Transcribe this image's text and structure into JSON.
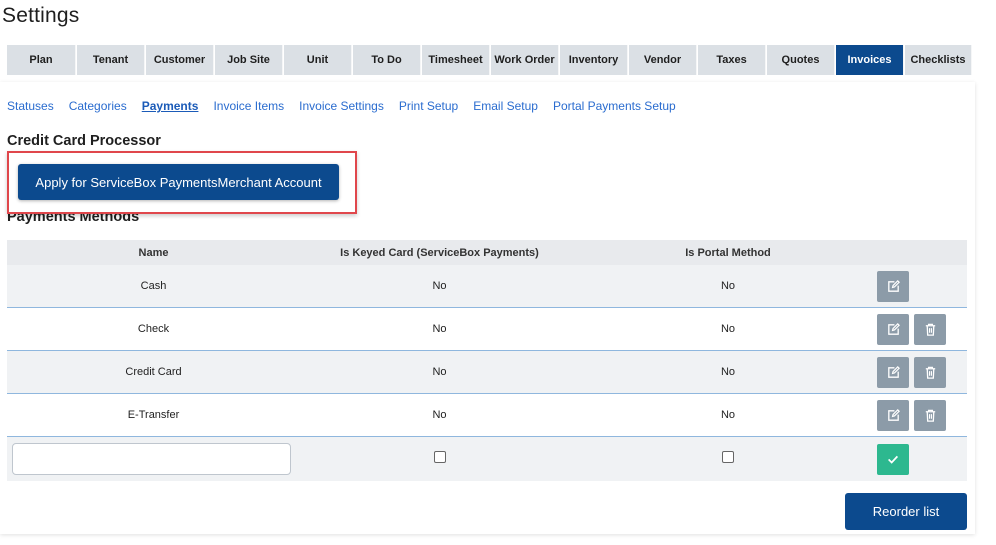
{
  "page": {
    "title": "Settings"
  },
  "tabs": [
    {
      "label": "Plan",
      "active": false
    },
    {
      "label": "Tenant",
      "active": false
    },
    {
      "label": "Customer",
      "active": false
    },
    {
      "label": "Job Site",
      "active": false
    },
    {
      "label": "Unit",
      "active": false
    },
    {
      "label": "To Do",
      "active": false
    },
    {
      "label": "Timesheet",
      "active": false
    },
    {
      "label": "Work Order",
      "active": false
    },
    {
      "label": "Inventory",
      "active": false
    },
    {
      "label": "Vendor",
      "active": false
    },
    {
      "label": "Taxes",
      "active": false
    },
    {
      "label": "Quotes",
      "active": false
    },
    {
      "label": "Invoices",
      "active": true
    },
    {
      "label": "Checklists",
      "active": false
    }
  ],
  "subnav": [
    {
      "label": "Statuses",
      "active": false
    },
    {
      "label": "Categories",
      "active": false
    },
    {
      "label": "Payments",
      "active": true
    },
    {
      "label": "Invoice Items",
      "active": false
    },
    {
      "label": "Invoice Settings",
      "active": false
    },
    {
      "label": "Print Setup",
      "active": false
    },
    {
      "label": "Email Setup",
      "active": false
    },
    {
      "label": "Portal Payments Setup",
      "active": false
    }
  ],
  "processor": {
    "title": "Credit Card Processor",
    "apply_label": "Apply for ServiceBox PaymentsMerchant Account"
  },
  "methods": {
    "title": "Payments Methods",
    "columns": [
      "Name",
      "Is Keyed Card (ServiceBox Payments)",
      "Is Portal Method"
    ],
    "rows": [
      {
        "name": "Cash",
        "keyed": "No",
        "portal": "No",
        "deletable": false
      },
      {
        "name": "Check",
        "keyed": "No",
        "portal": "No",
        "deletable": true
      },
      {
        "name": "Credit Card",
        "keyed": "No",
        "portal": "No",
        "deletable": true
      },
      {
        "name": "E-Transfer",
        "keyed": "No",
        "portal": "No",
        "deletable": true
      }
    ],
    "new_row": {
      "name_value": "",
      "keyed_checked": false,
      "portal_checked": false
    },
    "reorder_label": "Reorder list"
  },
  "colors": {
    "primary": "#0c4a8e",
    "tab_bg": "#dbe0e5",
    "link": "#2a6ccf",
    "highlight": "#e0474c",
    "success": "#2db88f",
    "icon_btn": "#8c9ba8"
  },
  "icons": {
    "edit": "edit-icon",
    "delete": "trash-icon",
    "confirm": "check-icon"
  }
}
